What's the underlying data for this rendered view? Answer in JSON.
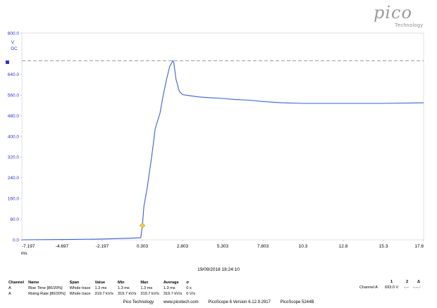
{
  "brand": {
    "logo": "pico",
    "logo_sub": "Technology"
  },
  "colors": {
    "trace": "#3b5fd6",
    "axis_text": "#2b37c9",
    "marker": "#f0d24a",
    "ref_line": "#999999"
  },
  "chart_data": {
    "type": "line",
    "title": "",
    "y_unit_top": "V",
    "y_coupling": "DC",
    "xlabel": "ms",
    "xlim": [
      -7.197,
      17.8
    ],
    "ylim": [
      0,
      800
    ],
    "x_ticks": [
      "-7.197",
      "-4.697",
      "-2.197",
      "0.303",
      "2.803",
      "5.303",
      "7.803",
      "10.3",
      "12.8",
      "15.3",
      "17.8"
    ],
    "y_ticks": [
      "0.0",
      "80.0",
      "160.0",
      "240.0",
      "320.0",
      "400.0",
      "480.0",
      "560.0",
      "640.0",
      "800.0"
    ],
    "reference_level": 693,
    "trigger_point": {
      "x": 0.303,
      "y": 55
    },
    "series": [
      {
        "x": [
          -7.197,
          -4.5,
          -2.197,
          -0.5,
          0.2,
          0.303,
          0.4,
          0.6,
          0.9,
          1.1,
          1.4,
          1.6,
          1.8,
          2.0,
          2.2,
          2.25,
          2.4,
          2.6,
          2.8,
          3.2,
          3.8,
          4.5,
          5.3,
          6.0,
          7.0,
          7.8,
          9.0,
          10.3,
          12.8,
          15.3,
          17.8
        ],
        "y": [
          0,
          1,
          3,
          6,
          8,
          55,
          130,
          200,
          330,
          430,
          490,
          560,
          620,
          670,
          693,
          688,
          620,
          575,
          562,
          558,
          553,
          550,
          547,
          543,
          540,
          535,
          530,
          528,
          528,
          528,
          530
        ]
      }
    ]
  },
  "footer": {
    "timestamp": "19/09/2018 18:24:10",
    "headers": [
      "Channel",
      "Name",
      "Span",
      "Value",
      "Min",
      "Max",
      "Average",
      "σ"
    ],
    "rows": [
      [
        "A",
        "Rise Time [80/20%]",
        "Whole trace",
        "1.3 ms",
        "1.3 ms",
        "1.3 ms",
        "1.3 ms",
        "0 s"
      ],
      [
        "A",
        "Rising Rate [80/20%]",
        "Whole trace",
        "319.7 kV/s",
        "319.7 kV/s",
        "319.7 kV/s",
        "319.7 kV/s",
        "0 V/s"
      ]
    ],
    "right_headers": [
      "1",
      "2",
      "Δ"
    ],
    "right_row": {
      "label": "Channel A",
      "v1": "693.0 V",
      "v2": "-.--",
      "vd": "-.--.-"
    },
    "credits": [
      "Pico Technology",
      "www.picotech.com",
      "PicoScope 6 Version 6.12.9.2917",
      "PicoScope 5244B"
    ]
  }
}
